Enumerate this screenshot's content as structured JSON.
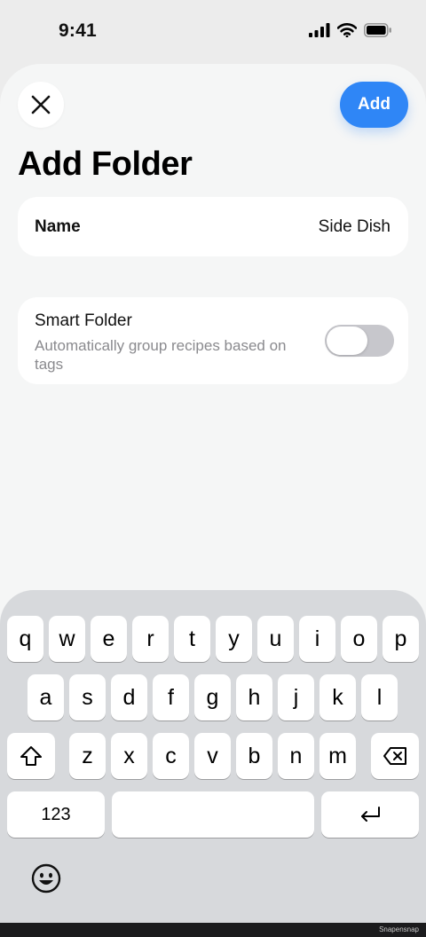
{
  "status_bar": {
    "time": "9:41"
  },
  "header": {
    "add_label": "Add",
    "title": "Add Folder"
  },
  "name_field": {
    "label": "Name",
    "value": "Side Dish"
  },
  "smart_folder": {
    "title": "Smart Folder",
    "description": "Automatically group recipes based on tags",
    "enabled": false
  },
  "keyboard": {
    "row1": [
      "q",
      "w",
      "e",
      "r",
      "t",
      "y",
      "u",
      "i",
      "o",
      "p"
    ],
    "row2": [
      "a",
      "s",
      "d",
      "f",
      "g",
      "h",
      "j",
      "k",
      "l"
    ],
    "row3": [
      "z",
      "x",
      "c",
      "v",
      "b",
      "n",
      "m"
    ],
    "numbers_label": "123"
  },
  "footer": {
    "watermark": "Snapensnap"
  },
  "colors": {
    "accent": "#2f86f6",
    "toggle_off": "#c7c7cc",
    "sheet": "#f5f6f6",
    "keyboard": "#d7d9dc"
  }
}
